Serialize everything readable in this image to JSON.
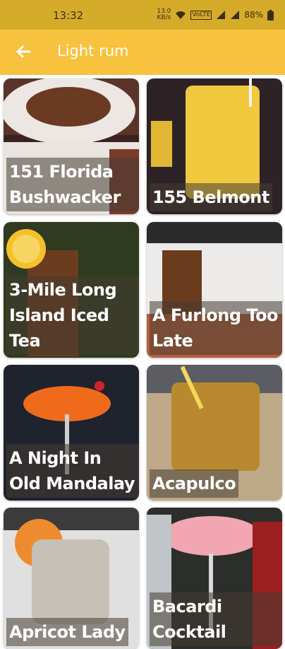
{
  "status_bar": {
    "time": "13:32",
    "net_speed": "13.0\nKB/s",
    "wifi_badge": "VoLTE",
    "battery": "88%"
  },
  "app_bar": {
    "title": "Light rum"
  },
  "cocktails": [
    {
      "name": "151 Florida Bushwacker"
    },
    {
      "name": "155 Belmont"
    },
    {
      "name": "3-Mile Long Island Iced Tea"
    },
    {
      "name": "A Furlong Too Late"
    },
    {
      "name": "A Night In Old Mandalay"
    },
    {
      "name": "Acapulco"
    },
    {
      "name": "Apricot Lady"
    },
    {
      "name": "Bacardi Cocktail"
    }
  ],
  "colors": {
    "status_bar": "#d5ab2a",
    "app_bar": "#f7c23d",
    "title_text": "#ffffff"
  }
}
